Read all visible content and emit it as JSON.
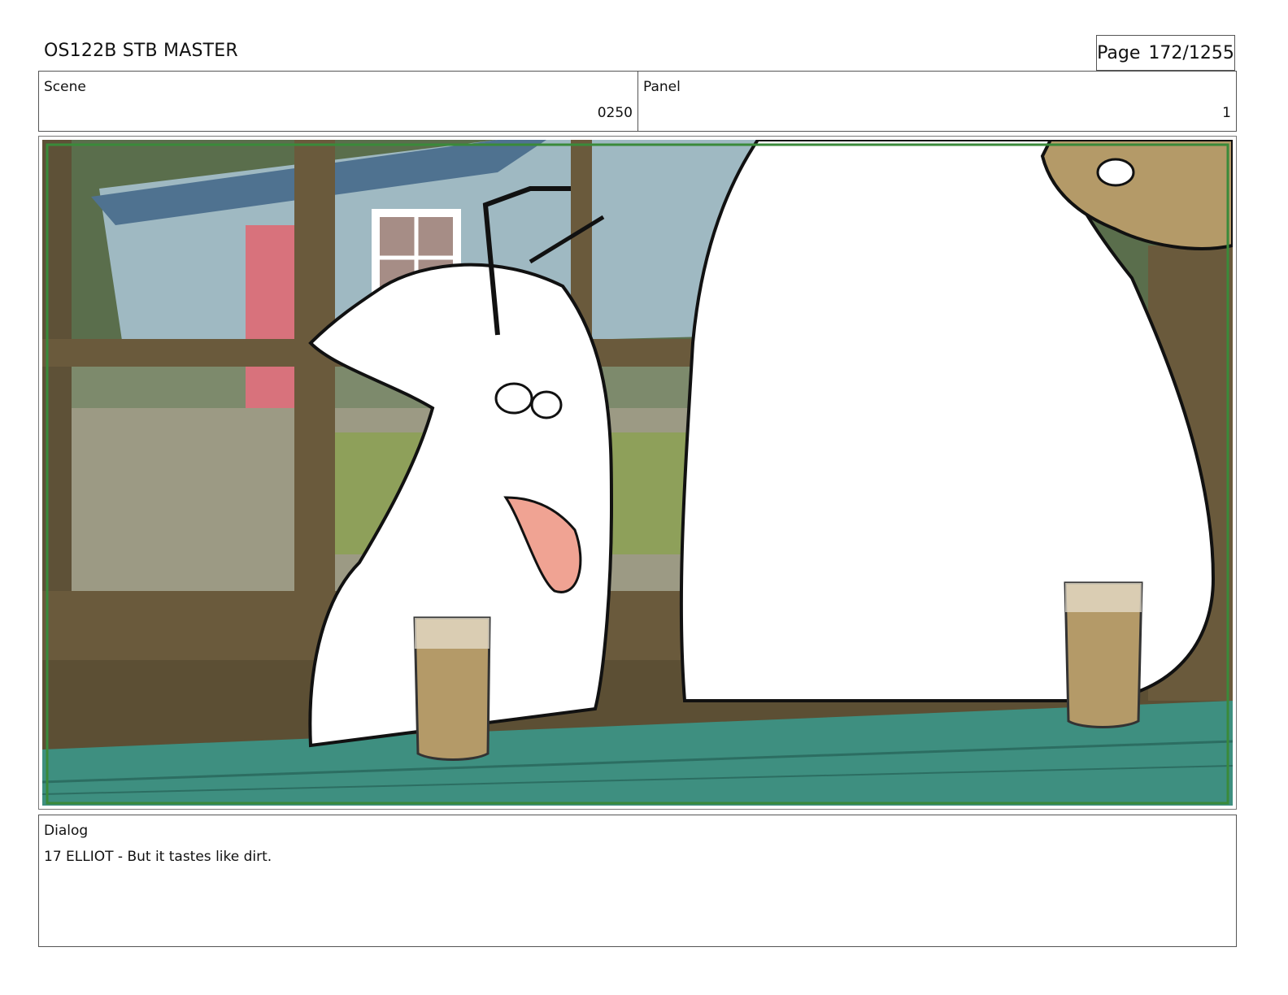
{
  "header": {
    "title": "OS122B STB MASTER",
    "page_label": "Page",
    "page_number": "172/1255"
  },
  "scene": {
    "label": "Scene",
    "value": "0250"
  },
  "panel": {
    "label": "Panel",
    "value": "1"
  },
  "dialog": {
    "label": "Dialog",
    "text": "17 ELLIOT - But it tastes like dirt."
  },
  "colors": {
    "frame_green": "#3a8a3a",
    "counter_teal": "#3e8f80",
    "wood_brown": "#6a5a3c",
    "cabin_blue": "#9fb9c2",
    "drink_tan": "#b49a68",
    "tongue_pink": "#f0a393"
  }
}
